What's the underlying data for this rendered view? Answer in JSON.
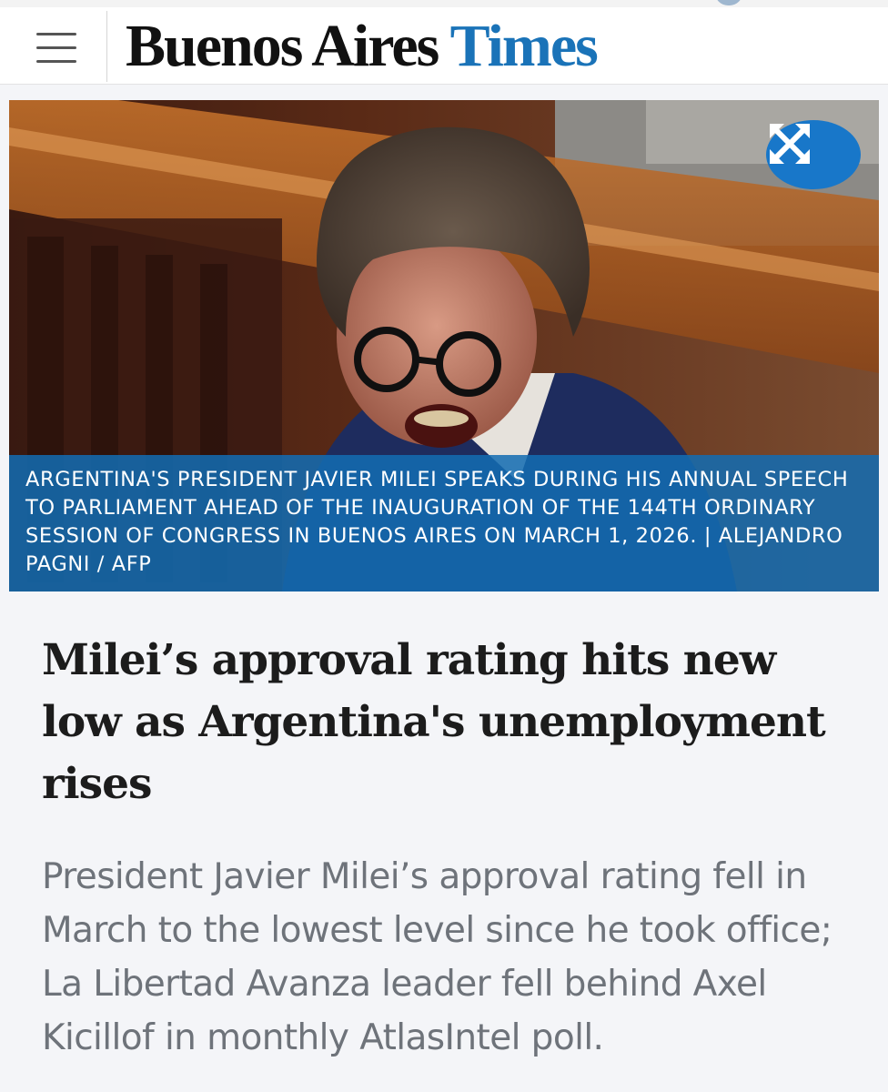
{
  "header": {
    "logo_part1": "Buenos Aires",
    "logo_part2": "Times",
    "menu_icon": "hamburger-menu-icon",
    "brand_color": "#1a73b8"
  },
  "hero": {
    "expand_icon": "expand-arrows-icon",
    "caption": "ARGENTINA'S PRESIDENT JAVIER MILEI SPEAKS DURING HIS ANNUAL SPEECH TO PARLIAMENT AHEAD OF THE INAUGURATION OF THE 144TH ORDINARY SESSION OF CONGRESS IN BUENOS AIRES ON MARCH 1, 2026. | ALEJANDRO PAGNI / AFP",
    "caption_bg": "#136cb2"
  },
  "article": {
    "headline": "Milei’s approval rating hits new low as Argentina's unemployment rises",
    "summary": "President Javier Milei’s approval rating fell in March to the lowest level since he took office; La Libertad Avanza leader fell behind Axel Kicillof in monthly AtlasIntel poll."
  }
}
